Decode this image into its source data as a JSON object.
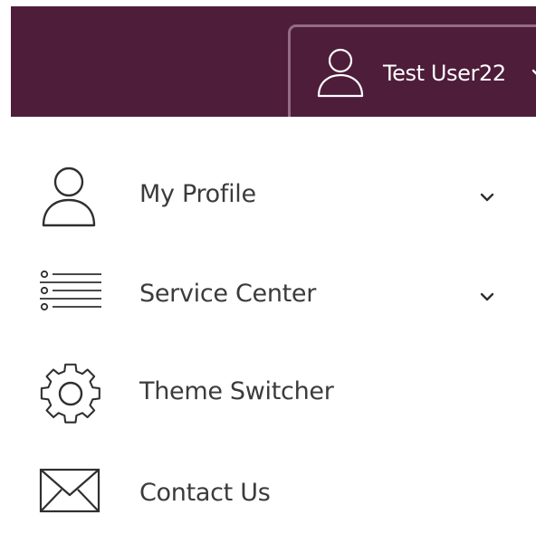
{
  "header": {
    "user_name": "Test User22",
    "avatar_icon": "user-icon",
    "dropdown_icon": "chevron-down-icon",
    "background_color": "#4e1d3a",
    "border_color": "#946b86"
  },
  "menu": {
    "items": [
      {
        "label": "My Profile",
        "icon": "user-icon",
        "has_submenu": true
      },
      {
        "label": "Service Center",
        "icon": "list-icon",
        "has_submenu": true
      },
      {
        "label": "Theme Switcher",
        "icon": "gear-icon",
        "has_submenu": false
      },
      {
        "label": "Contact Us",
        "icon": "envelope-icon",
        "has_submenu": false
      }
    ]
  }
}
